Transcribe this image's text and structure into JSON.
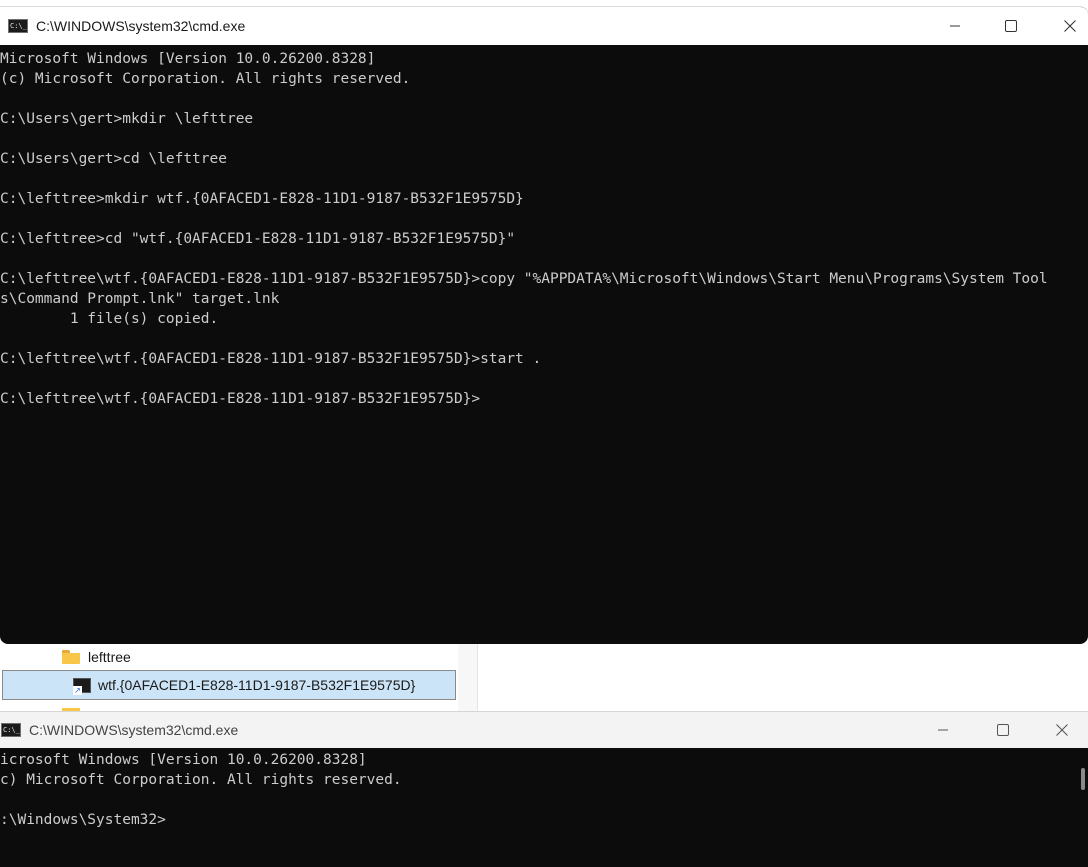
{
  "top_window": {
    "title": "C:\\WINDOWS\\system32\\cmd.exe",
    "icon": "console-icon",
    "controls": [
      "minimize-icon",
      "maximize-icon",
      "close-icon"
    ],
    "lines": [
      "Microsoft Windows [Version 10.0.26200.8328]",
      "(c) Microsoft Corporation. All rights reserved.",
      "",
      "C:\\Users\\gert>mkdir \\lefttree",
      "",
      "C:\\Users\\gert>cd \\lefttree",
      "",
      "C:\\lefttree>mkdir wtf.{0AFACED1-E828-11D1-9187-B532F1E9575D}",
      "",
      "C:\\lefttree>cd \"wtf.{0AFACED1-E828-11D1-9187-B532F1E9575D}\"",
      "",
      "C:\\lefttree\\wtf.{0AFACED1-E828-11D1-9187-B532F1E9575D}>copy \"%APPDATA%\\Microsoft\\Windows\\Start Menu\\Programs\\System Tool",
      "s\\Command Prompt.lnk\" target.lnk",
      "        1 file(s) copied.",
      "",
      "C:\\lefttree\\wtf.{0AFACED1-E828-11D1-9187-B532F1E9575D}>start .",
      "",
      "C:\\lefttree\\wtf.{0AFACED1-E828-11D1-9187-B532F1E9575D}>"
    ]
  },
  "explorer": {
    "tree_items": [
      {
        "label": "lefttree",
        "icon": "folder-icon"
      },
      {
        "label": "wtf.{0AFACED1-E828-11D1-9187-B532F1E9575D}",
        "icon": "shortcut-icon",
        "selected": true
      }
    ]
  },
  "bottom_window": {
    "title": "C:\\WINDOWS\\system32\\cmd.exe",
    "icon": "console-icon",
    "controls": [
      "minimize-icon",
      "maximize-icon",
      "close-icon"
    ],
    "lines": [
      "icrosoft Windows [Version 10.0.26200.8328]",
      "c) Microsoft Corporation. All rights reserved.",
      "",
      ":\\Windows\\System32>"
    ]
  },
  "colors": {
    "console_bg": "#0c0c0c",
    "console_text": "#cccccc",
    "selection": "#cce4f7",
    "folder": "#f8c74a"
  }
}
